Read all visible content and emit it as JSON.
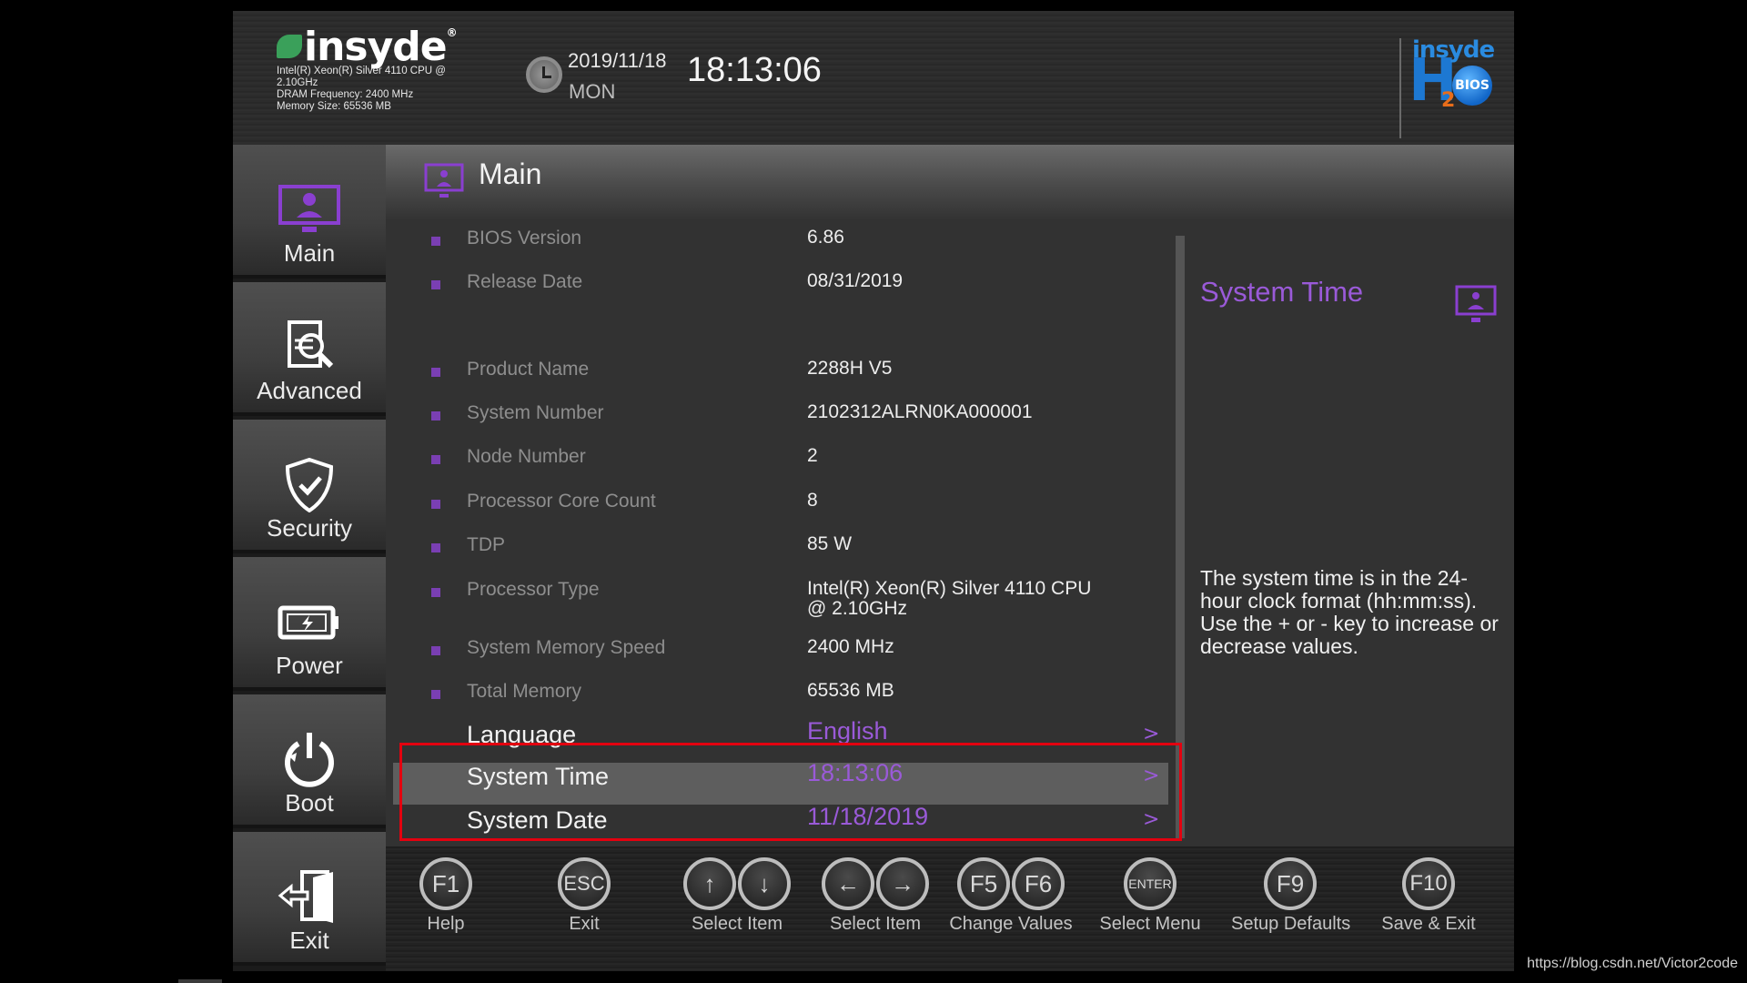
{
  "header": {
    "brand": "insyde",
    "cpu_line1": "Intel(R) Xeon(R) Silver 4110 CPU @",
    "cpu_line2": "2.10GHz",
    "dram": "DRAM Frequency: 2400 MHz",
    "memory": "Memory Size: 65536 MB",
    "date": "2019/11/18",
    "day": "MON",
    "time": "18:13:06",
    "product_logo": {
      "top": "insyde",
      "main": "H",
      "sub": "2",
      "badge": "BIOS"
    }
  },
  "sidebar": {
    "items": [
      {
        "label": "Main",
        "icon": "monitor-user-icon",
        "active": true
      },
      {
        "label": "Advanced",
        "icon": "document-search-icon",
        "active": false
      },
      {
        "label": "Security",
        "icon": "shield-check-icon",
        "active": false
      },
      {
        "label": "Power",
        "icon": "battery-bolt-icon",
        "active": false
      },
      {
        "label": "Boot",
        "icon": "power-icon",
        "active": false
      },
      {
        "label": "Exit",
        "icon": "exit-door-icon",
        "active": false
      }
    ]
  },
  "main": {
    "title": "Main",
    "info_rows": [
      {
        "label": "BIOS Version",
        "value": "6.86"
      },
      {
        "label": "Release Date",
        "value": "08/31/2019"
      },
      {
        "label": "Product Name",
        "value": "2288H V5"
      },
      {
        "label": "System Number",
        "value": "2102312ALRN0KA000001"
      },
      {
        "label": "Node Number",
        "value": "2"
      },
      {
        "label": "Processor Core Count",
        "value": "8"
      },
      {
        "label": "TDP",
        "value": "85 W"
      },
      {
        "label": "Processor Type",
        "value": "Intel(R) Xeon(R) Silver 4110 CPU",
        "value2": "@ 2.10GHz"
      },
      {
        "label": "System Memory Speed",
        "value": "2400 MHz"
      },
      {
        "label": "Total Memory",
        "value": "65536 MB"
      }
    ],
    "settings": [
      {
        "label": "Language",
        "value": "English",
        "chevron": ">"
      },
      {
        "label": "System Time",
        "value": "18:13:06",
        "chevron": ">",
        "highlighted": true
      },
      {
        "label": "System Date",
        "value": "11/18/2019",
        "chevron": ">"
      }
    ]
  },
  "help": {
    "title": "System Time",
    "description": "The system time is in the 24-hour clock format (hh:mm:ss). Use the + or - key to increase or decrease values."
  },
  "footer": {
    "keys": [
      {
        "keys": [
          "F1"
        ],
        "label": "Help"
      },
      {
        "keys": [
          "ESC"
        ],
        "label": "Exit"
      },
      {
        "keys": [
          "↑",
          "↓"
        ],
        "label": "Select Item"
      },
      {
        "keys": [
          "←",
          "→"
        ],
        "label": "Select Item"
      },
      {
        "keys": [
          "F5",
          "F6"
        ],
        "label": "Change Values"
      },
      {
        "keys": [
          "ENTER"
        ],
        "label": "Select Menu"
      },
      {
        "keys": [
          "F9"
        ],
        "label": "Setup Defaults"
      },
      {
        "keys": [
          "F10"
        ],
        "label": "Save & Exit"
      }
    ]
  },
  "colors": {
    "accent": "#9a5ad8",
    "bullet": "#7a3fb3",
    "annotation": "#e3000f",
    "brand_green": "#3aa05a",
    "h2o_blue": "#1d78d2"
  },
  "watermark": "https://blog.csdn.net/Victor2code"
}
